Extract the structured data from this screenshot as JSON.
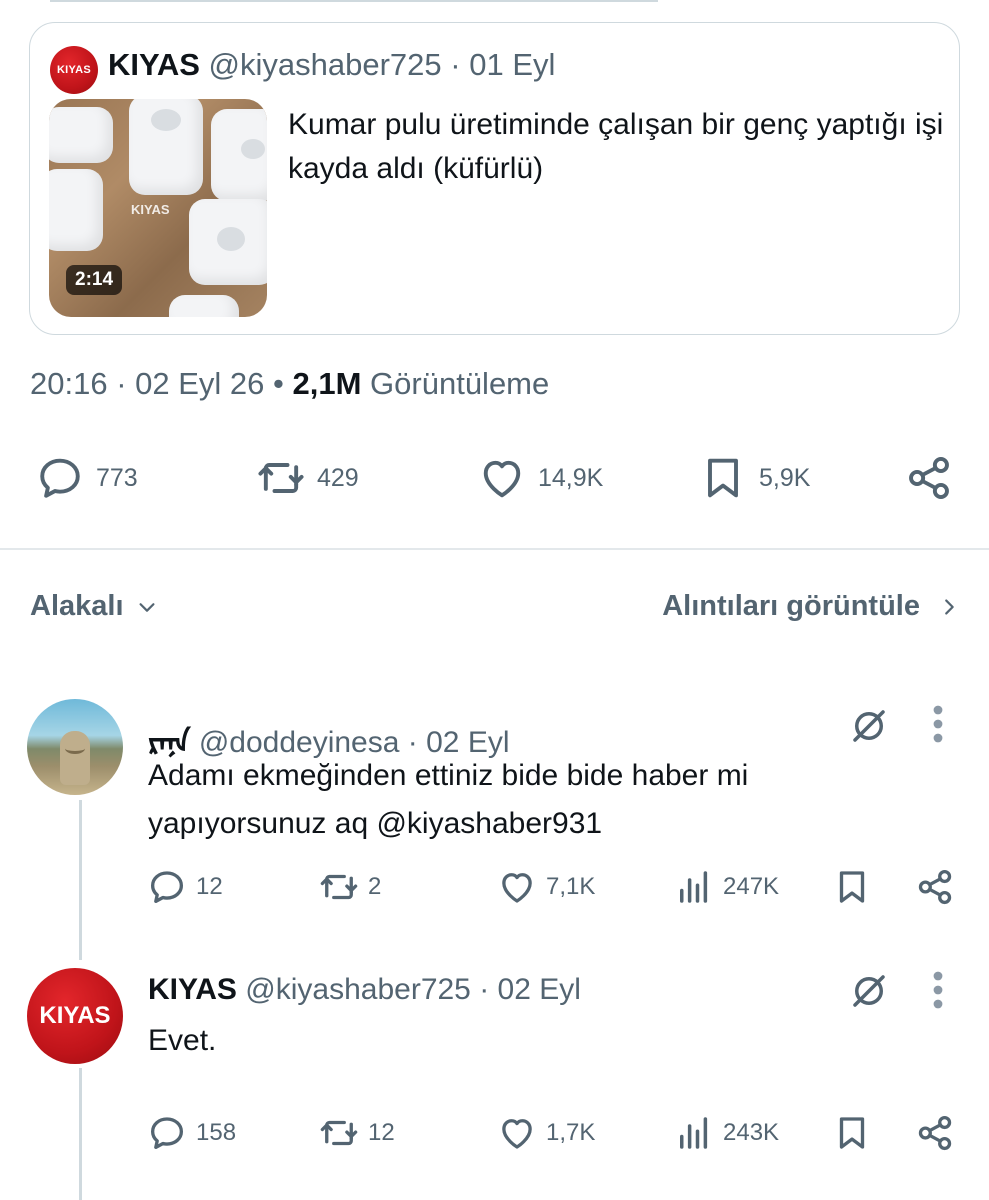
{
  "quoted_tweet": {
    "avatar_text": "KIYAS",
    "name": "KIYAS",
    "handle": "@kiyashaber725",
    "separator": "·",
    "date": "01 Eyl",
    "thumbnail_watermark": "KIYAS",
    "video_duration": "2:14",
    "text": "Kumar pulu üretiminde çalışan bir genç yaptığı işi kayda aldı (küfürlü)"
  },
  "meta": {
    "time": "20:16",
    "date": "02 Eyl 26",
    "views_count": "2,1M",
    "views_label": "Görüntüleme"
  },
  "actions": {
    "replies": "773",
    "retweets": "429",
    "likes": "14,9K",
    "bookmarks": "5,9K"
  },
  "sort": {
    "left_label": "Alakalı",
    "right_label": "Alıntıları görüntüle"
  },
  "replies": [
    {
      "name": "ᠷᠡᠨᠡ",
      "handle": "@doddeyinesa",
      "date": "02 Eyl",
      "text": "Adamı ekmeğinden ettiniz bide  bide haber mi yapıyorsunuz aq @kiyashaber931",
      "replies": "12",
      "retweets": "2",
      "likes": "7,1K",
      "views": "247K"
    },
    {
      "avatar_text": "KIYAS",
      "name": "KIYAS",
      "handle": "@kiyashaber725",
      "date": "02 Eyl",
      "text": "Evet.",
      "replies": "158",
      "retweets": "12",
      "likes": "1,7K",
      "views": "243K"
    }
  ],
  "colors": {
    "text_primary": "#0f1419",
    "text_secondary": "#536471",
    "border": "#cfd9de",
    "brand_red": "#c0141a"
  },
  "icons": [
    "reply-icon",
    "retweet-icon",
    "like-icon",
    "bookmark-icon",
    "share-icon",
    "views-icon",
    "grok-icon",
    "more-icon",
    "chevron-down-icon",
    "chevron-right-icon"
  ]
}
